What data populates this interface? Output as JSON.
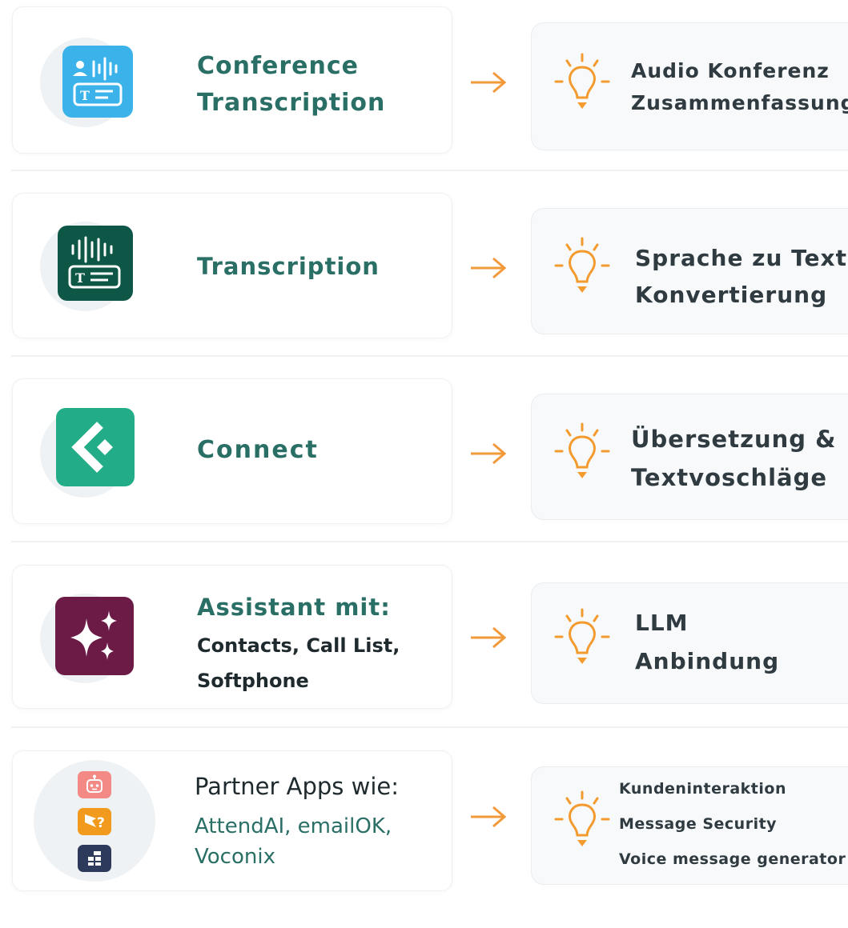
{
  "colors": {
    "title_green": "#2a6f66",
    "arrow_orange": "#f2993a",
    "bulb_orange": "#f39b2e",
    "dark_text": "#1f2a2e"
  },
  "rows": [
    {
      "icon": "conference-transcription-icon",
      "title_lines": [
        "Conference",
        "Transcription"
      ],
      "result_lines": [
        "Audio Konferenz",
        "Zusammenfassung"
      ]
    },
    {
      "icon": "transcription-icon",
      "title_lines": [
        "Transcription"
      ],
      "result_lines": [
        "Sprache zu Text",
        "Konvertierung"
      ]
    },
    {
      "icon": "connect-icon",
      "title_lines": [
        "Connect"
      ],
      "result_lines": [
        "Übersetzung &",
        "Textvoschläge"
      ]
    },
    {
      "icon": "assistant-sparkle-icon",
      "title_lines": [
        "Assistant mit:"
      ],
      "sub_lines": [
        "Contacts, Call List,",
        "Softphone"
      ],
      "result_lines": [
        "LLM",
        "Anbindung"
      ]
    },
    {
      "icons": [
        "robot-icon",
        "question-chat-icon",
        "grid-app-icon"
      ],
      "title_lines": [
        "Partner Apps wie:"
      ],
      "sub_lines": [
        "AttendAI, emailOK,",
        "Voconix"
      ],
      "result_lines": [
        "Kundeninteraktion",
        "Message Security",
        "Voice message generator"
      ]
    }
  ]
}
